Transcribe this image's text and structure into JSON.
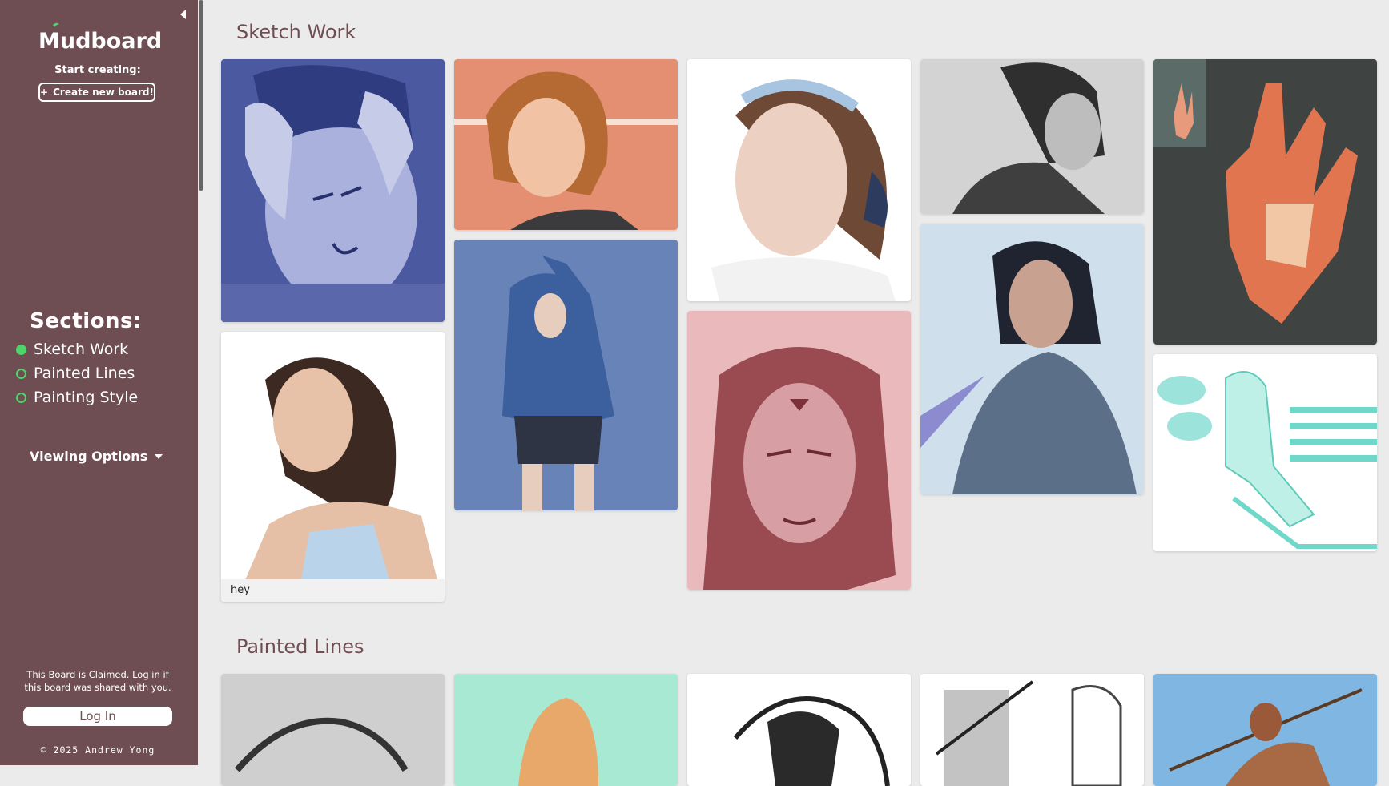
{
  "app": {
    "logo_text": "Mudboard"
  },
  "sidebar": {
    "start_label": "Start creating:",
    "create_button": {
      "icon": "plus-icon",
      "label": "Create new board!"
    },
    "sections_title": "Sections:",
    "sections": [
      {
        "label": "Sketch Work",
        "active": true
      },
      {
        "label": "Painted Lines",
        "active": false
      },
      {
        "label": "Painting Style",
        "active": false
      }
    ],
    "viewing_options": "Viewing Options",
    "claim_text": "This Board is Claimed. Log in if this board was shared with you.",
    "login_button": "Log In",
    "copyright": "© 2025 Andrew Yong"
  },
  "colors": {
    "sidebar": "#6f4e53",
    "accent": "#4fd36b",
    "background": "#ebebeb"
  },
  "board": {
    "sections": [
      {
        "title": "Sketch Work",
        "cards": [
          {
            "subject": "man-head-in-hands",
            "caption": ""
          },
          {
            "subject": "woman-bob-hair-orange",
            "caption": ""
          },
          {
            "subject": "woman-headband-portrait",
            "caption": ""
          },
          {
            "subject": "woman-grayscale-profile",
            "caption": ""
          },
          {
            "subject": "hand-gesture-orange",
            "caption": ""
          },
          {
            "subject": "woman-hair-tank-top",
            "caption": "hey"
          },
          {
            "subject": "figure-hoodie-blue",
            "caption": ""
          },
          {
            "subject": "woman-pink-portrait",
            "caption": ""
          },
          {
            "subject": "man-blue-jacket",
            "caption": ""
          },
          {
            "subject": "teal-sketch-bench-with-speech-bubbles",
            "caption": ""
          }
        ]
      },
      {
        "title": "Painted Lines",
        "cards": [
          {
            "subject": "gray-sketch-hair"
          },
          {
            "subject": "figure-mint-background"
          },
          {
            "subject": "ink-sketch-portrait"
          },
          {
            "subject": "armored-figure-sketches"
          },
          {
            "subject": "figure-with-spear-sky"
          }
        ]
      }
    ]
  }
}
